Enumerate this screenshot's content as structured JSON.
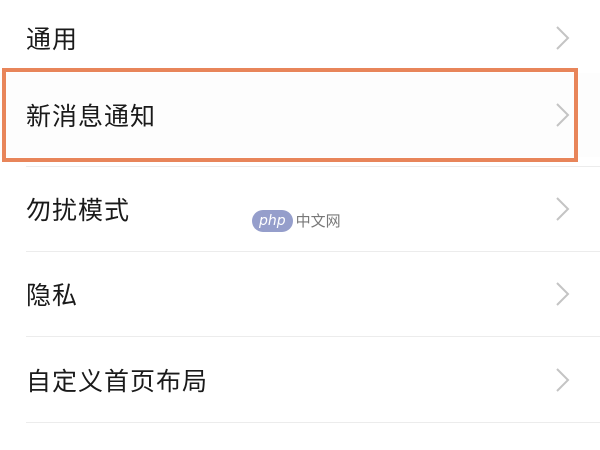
{
  "settings": {
    "items": [
      {
        "label": "通用",
        "icon": "chevron-right-icon"
      },
      {
        "label": "新消息通知",
        "icon": "chevron-right-icon"
      },
      {
        "label": "勿扰模式",
        "icon": "chevron-right-icon"
      },
      {
        "label": "隐私",
        "icon": "chevron-right-icon"
      },
      {
        "label": "自定义首页布局",
        "icon": "chevron-right-icon"
      }
    ]
  },
  "highlight": {
    "item": "新消息通知",
    "color": "#e8855a"
  },
  "watermark": {
    "badge": "php",
    "text": "中文网"
  },
  "colors": {
    "text": "#1a1a1a",
    "chevron": "#c4c4c4",
    "divider": "#ececec",
    "background": "#ffffff"
  }
}
